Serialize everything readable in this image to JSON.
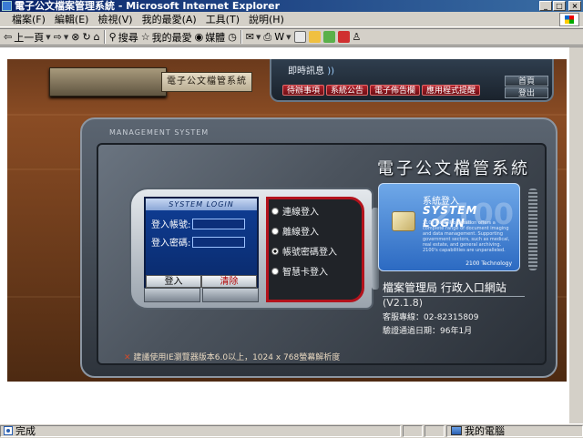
{
  "window": {
    "title": "電子公文檔案管理系統 - Microsoft Internet Explorer",
    "controls": {
      "minimize": "_",
      "maximize": "□",
      "close": "×"
    }
  },
  "menubar": {
    "items": [
      "檔案(F)",
      "編輯(E)",
      "檢視(V)",
      "我的最愛(A)",
      "工具(T)",
      "說明(H)"
    ]
  },
  "toolbar": {
    "back_label": "上一頁",
    "search_label": "搜尋",
    "favorites_label": "我的最愛",
    "media_label": "媒體"
  },
  "page": {
    "plaque_label": "電子公文檔管系統",
    "info_panel": {
      "title": "即時訊息",
      "tabs": [
        "待辦事項",
        "系統公告",
        "電子佈告欄",
        "應用程式提醒"
      ],
      "side_buttons": [
        "首頁",
        "登出"
      ]
    },
    "device_label": "MANAGEMENT SYSTEM",
    "system_title": "電子公文檔管系統",
    "login": {
      "header": "SYSTEM LOGIN",
      "account_label": "登入帳號:",
      "password_label": "登入密碼:",
      "account_value": "",
      "password_value": "",
      "login_button": "登入",
      "clear_button": "清除"
    },
    "login_modes": [
      {
        "label": "連線登入",
        "selected": false
      },
      {
        "label": "離線登入",
        "selected": false
      },
      {
        "label": "帳號密碼登入",
        "selected": true
      },
      {
        "label": "智慧卡登入",
        "selected": false
      }
    ],
    "smart_card": {
      "title": "系統登入",
      "subtitle": "SYSTEM LOGIN",
      "description": "2100 GeMs Corporation offers a complete range of document imaging and data management. Supporting government sectors, such as medical, real estate, and general archiving. 2100's capabilities are unparalleled.",
      "brand": "2100 Technology",
      "logo": "2100"
    },
    "agency": {
      "name": "檔案管理局 行政入口網站",
      "version": "(V2.1.8)",
      "hotline": "客服專線：02-82315809",
      "verified": "驗證通過日期：96年1月"
    },
    "browser_note": "建議使用IE瀏覽器版本6.0以上，1024 x 768螢幕解析度"
  },
  "statusbar": {
    "status_text": "完成",
    "zone_text": "我的電腦"
  }
}
